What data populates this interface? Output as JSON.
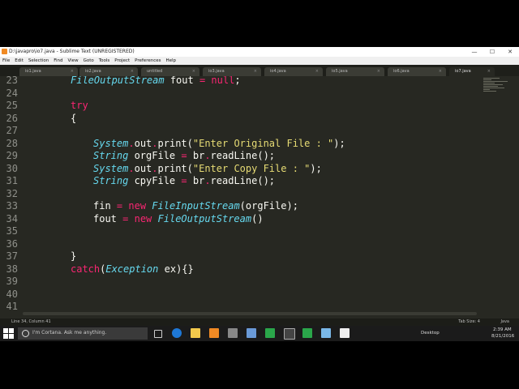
{
  "window": {
    "title": "D:\\javapro\\io7.java - Sublime Text (UNREGISTERED)",
    "controls": [
      "—",
      "☐",
      "✕"
    ]
  },
  "menu": [
    "File",
    "Edit",
    "Selection",
    "Find",
    "View",
    "Goto",
    "Tools",
    "Project",
    "Preferences",
    "Help"
  ],
  "tabs": [
    {
      "label": "io1.java",
      "active": false
    },
    {
      "label": "io2.java",
      "active": false
    },
    {
      "label": "untitled",
      "active": false
    },
    {
      "label": "io3.java",
      "active": false
    },
    {
      "label": "io4.java",
      "active": false
    },
    {
      "label": "io5.java",
      "active": false
    },
    {
      "label": "io6.java",
      "active": false
    },
    {
      "label": "io7.java",
      "active": true
    }
  ],
  "code_lines": [
    {
      "num": "23",
      "text": "FileOutputStream fout = null;"
    },
    {
      "num": "24",
      "text": ""
    },
    {
      "num": "25",
      "text": "try"
    },
    {
      "num": "26",
      "text": "{"
    },
    {
      "num": "27",
      "text": ""
    },
    {
      "num": "28",
      "text": "System.out.print(\"Enter Original File : \");"
    },
    {
      "num": "29",
      "text": "String orgFile = br.readLine();"
    },
    {
      "num": "30",
      "text": "System.out.print(\"Enter Copy File : \");"
    },
    {
      "num": "31",
      "text": "String cpyFile = br.readLine();"
    },
    {
      "num": "32",
      "text": ""
    },
    {
      "num": "33",
      "text": "fin = new FileInputStream(orgFile);"
    },
    {
      "num": "34",
      "text": "fout = new FileOutputStream()"
    },
    {
      "num": "35",
      "text": ""
    },
    {
      "num": "36",
      "text": ""
    },
    {
      "num": "37",
      "text": "}"
    },
    {
      "num": "38",
      "text": "catch(Exception ex){}"
    },
    {
      "num": "39",
      "text": ""
    },
    {
      "num": "40",
      "text": ""
    },
    {
      "num": "41",
      "text": ""
    }
  ],
  "status": {
    "position": "Line 34, Column 41",
    "tab_size": "Tab Size: 4",
    "language": "Java"
  },
  "taskbar": {
    "search_placeholder": "I'm Cortana. Ask me anything.",
    "desktop_label": "Desktop",
    "time": "2:39 AM",
    "date": "8/21/2016"
  }
}
